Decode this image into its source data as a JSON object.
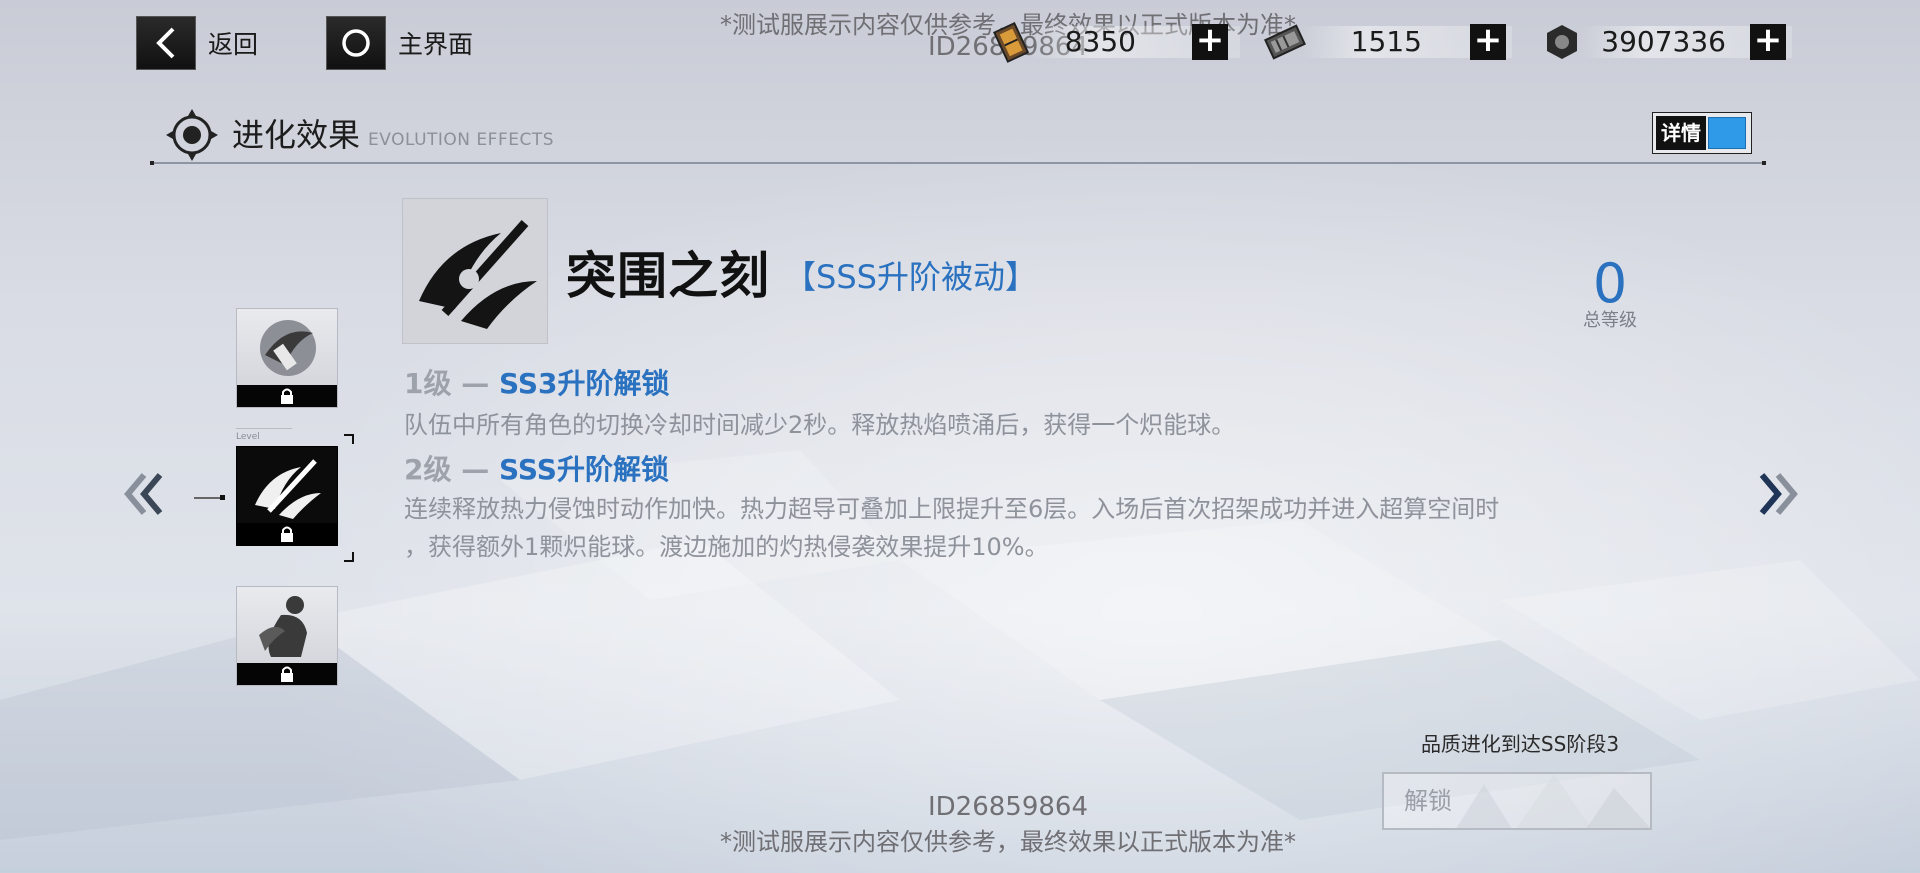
{
  "top_bar": {
    "back_label": "返回",
    "home_label": "主界面",
    "watermark_notice": "*测试服展示内容仅供参考，最终效果以正式版本为准*",
    "watermark_id": "ID26859864",
    "resources": [
      {
        "icon": "ticket-icon",
        "value": "8350"
      },
      {
        "icon": "battery-icon",
        "value": "1515"
      },
      {
        "icon": "hex-nut-icon",
        "value": "3907336"
      }
    ],
    "plus_symbol": "+"
  },
  "section": {
    "title": "进化效果",
    "subtitle": "EVOLUTION EFFECTS",
    "detail_toggle_label": "详情",
    "detail_toggle_on": true
  },
  "skill_list": {
    "level_caption": "Level",
    "items": [
      {
        "icon": "wing-emblem-icon",
        "locked": true,
        "selected": false
      },
      {
        "icon": "slash-emblem-icon",
        "locked": true,
        "selected": true
      },
      {
        "icon": "figure-emblem-icon",
        "locked": true,
        "selected": false
      }
    ]
  },
  "skill": {
    "name": "突围之刻",
    "tag": "【SSS升阶被动】",
    "total_level": "0",
    "total_level_label": "总等级",
    "levels": [
      {
        "prefix": "1级 — ",
        "unlock": "SS3升阶解锁",
        "lines": [
          "队伍中所有角色的切换冷却时间减少2秒。释放热焰喷涌后，获得一个炽能球。"
        ]
      },
      {
        "prefix": "2级 — ",
        "unlock": "SSS升阶解锁",
        "lines": [
          "连续释放热力侵蚀时动作加快。热力超导可叠加上限提升至6层。入场后首次招架成功并进入超算空间时",
          "，获得额外1颗炽能球。渡边施加的灼热侵袭效果提升10%。"
        ]
      }
    ]
  },
  "footer": {
    "condition": "品质进化到达SS阶段3",
    "unlock_button": "解锁",
    "watermark_id": "ID26859864",
    "watermark_notice": "*测试服展示内容仅供参考，最终效果以正式版本为准*"
  },
  "colors": {
    "accent_blue": "#2a72c0",
    "toggle_blue": "#2f9be8",
    "dark": "#111111",
    "muted_text": "#8e929b"
  }
}
